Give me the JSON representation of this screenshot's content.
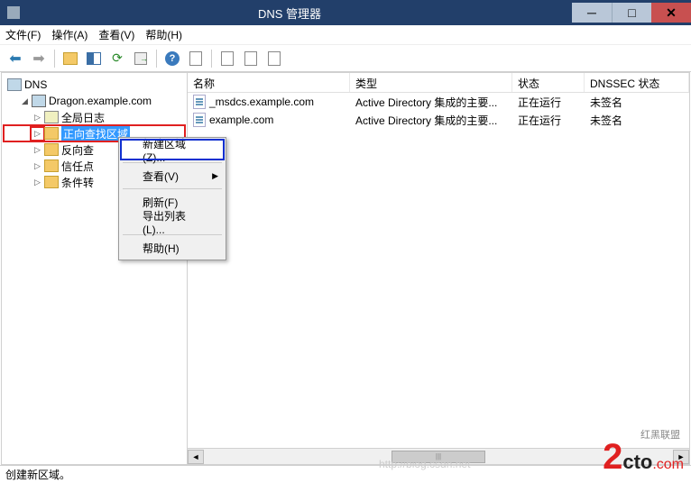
{
  "titlebar": {
    "title": "DNS 管理器"
  },
  "menubar": {
    "file": "文件(F)",
    "action": "操作(A)",
    "view": "查看(V)",
    "help": "帮助(H)"
  },
  "tree": {
    "root": "DNS",
    "server": "Dragon.example.com",
    "nodes": {
      "global_log": "全局日志",
      "forward_zone": "正向查找区域",
      "reverse_zone": "反向查",
      "trust_points": "信任点",
      "conditional_fwd": "条件转"
    }
  },
  "columns": {
    "name": "名称",
    "type": "类型",
    "status": "状态",
    "dnssec": "DNSSEC 状态"
  },
  "rows": [
    {
      "name": "_msdcs.example.com",
      "type": "Active Directory 集成的主要...",
      "status": "正在运行",
      "dnssec": "未签名"
    },
    {
      "name": "example.com",
      "type": "Active Directory 集成的主要...",
      "status": "正在运行",
      "dnssec": "未签名"
    }
  ],
  "context_menu": {
    "new_zone": "新建区域(Z)...",
    "view": "查看(V)",
    "refresh": "刷新(F)",
    "export_list": "导出列表(L)...",
    "help": "帮助(H)"
  },
  "statusbar": {
    "text": "创建新区域。"
  },
  "watermark": {
    "two": "2",
    "cto": "cto",
    "com": ".com",
    "sub": "红黑联盟",
    "url": "http://blog.csdn.net"
  }
}
